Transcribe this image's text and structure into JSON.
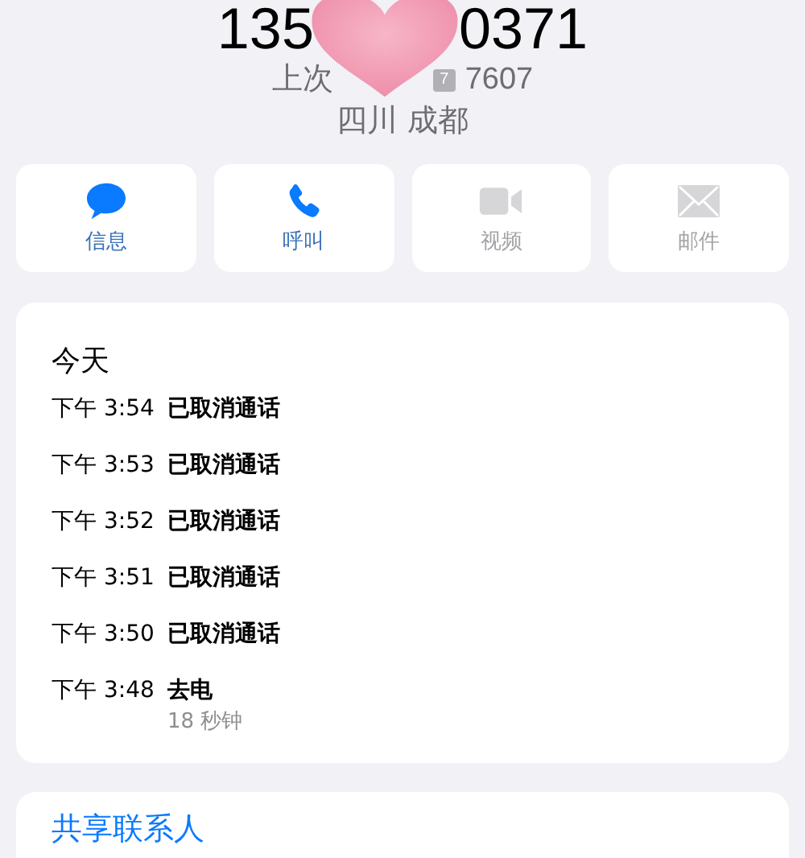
{
  "header": {
    "number_start": "135",
    "number_end": "0371",
    "last_used_label": "上次",
    "sim_badge": "7",
    "sim_number": "7607",
    "location": "四川 成都"
  },
  "actions": [
    {
      "kind": "message",
      "label": "信息",
      "disabled": false
    },
    {
      "kind": "call",
      "label": "呼叫",
      "disabled": false
    },
    {
      "kind": "video",
      "label": "视频",
      "disabled": true
    },
    {
      "kind": "mail",
      "label": "邮件",
      "disabled": true
    }
  ],
  "call_log": {
    "heading": "今天",
    "entries": [
      {
        "time": "下午 3:54",
        "status": "已取消通话"
      },
      {
        "time": "下午 3:53",
        "status": "已取消通话"
      },
      {
        "time": "下午 3:52",
        "status": "已取消通话"
      },
      {
        "time": "下午 3:51",
        "status": "已取消通话"
      },
      {
        "time": "下午 3:50",
        "status": "已取消通话"
      },
      {
        "time": "下午 3:48",
        "status": "去电",
        "duration": "18 秒钟"
      }
    ]
  },
  "share_contact": "共享联系人"
}
